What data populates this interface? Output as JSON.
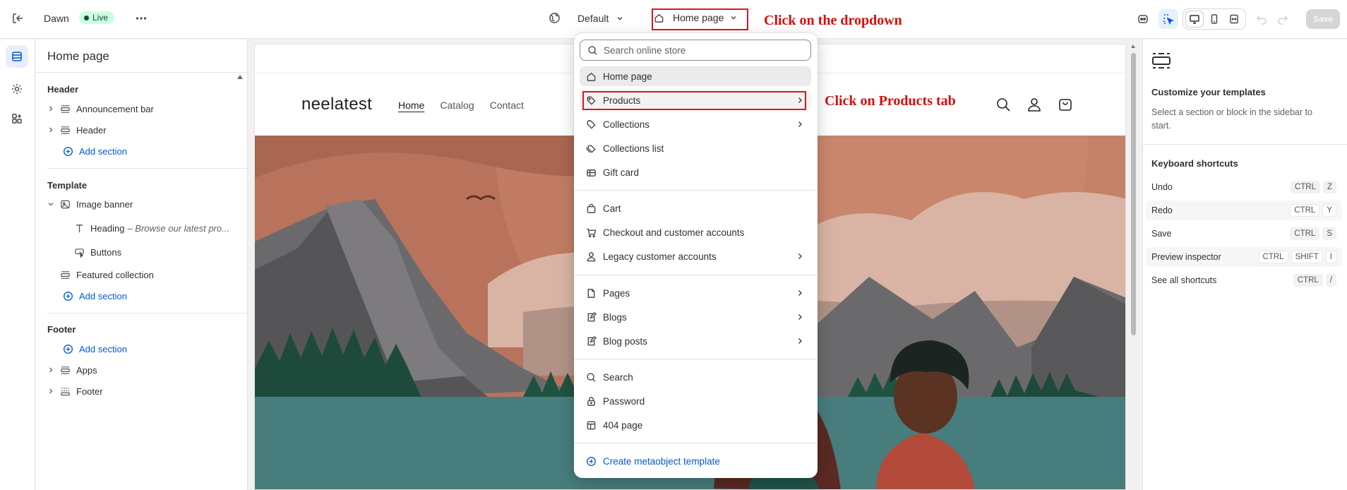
{
  "topbar": {
    "theme_name": "Dawn",
    "live_badge": "Live",
    "template_select": "Default",
    "page_select": "Home page",
    "save_label": "Save"
  },
  "annotations": {
    "dropdown": "Click on the dropdown",
    "products": "Click on Products tab"
  },
  "sidebar": {
    "title": "Home page",
    "header_group": {
      "heading": "Header",
      "items": [
        "Announcement bar",
        "Header"
      ],
      "add_section": "Add section"
    },
    "template_group": {
      "heading": "Template",
      "image_banner": "Image banner",
      "heading_block_label": "Heading",
      "heading_block_detail": "– Browse our latest pro...",
      "buttons_block": "Buttons",
      "featured_collection": "Featured collection",
      "add_section": "Add section"
    },
    "footer_group": {
      "heading": "Footer",
      "add_section": "Add section",
      "items": [
        "Apps",
        "Footer"
      ]
    }
  },
  "preview": {
    "store_name": "neelatest",
    "nav": [
      "Home",
      "Catalog",
      "Contact"
    ]
  },
  "menu": {
    "search_placeholder": "Search online store",
    "items": {
      "home_page": "Home page",
      "products": "Products",
      "collections": "Collections",
      "collections_list": "Collections list",
      "gift_card": "Gift card",
      "cart": "Cart",
      "checkout": "Checkout and customer accounts",
      "legacy_accounts": "Legacy customer accounts",
      "pages": "Pages",
      "blogs": "Blogs",
      "blog_posts": "Blog posts",
      "search": "Search",
      "password": "Password",
      "not_found": "404 page",
      "create_metaobject": "Create metaobject template"
    }
  },
  "right_panel": {
    "title": "Customize your templates",
    "description": "Select a section or block in the sidebar to start.",
    "shortcuts_title": "Keyboard shortcuts",
    "shortcuts": [
      {
        "label": "Undo",
        "keys": [
          "CTRL",
          "Z"
        ]
      },
      {
        "label": "Redo",
        "keys": [
          "CTRL",
          "Y"
        ]
      },
      {
        "label": "Save",
        "keys": [
          "CTRL",
          "S"
        ]
      },
      {
        "label": "Preview inspector",
        "keys": [
          "CTRL",
          "SHIFT",
          "I"
        ]
      },
      {
        "label": "See all shortcuts",
        "keys": [
          "CTRL",
          "/"
        ]
      }
    ]
  },
  "colors": {
    "accent": "#005bd3",
    "annotation": "#d40f0f",
    "live_bg": "#cdfee1"
  }
}
